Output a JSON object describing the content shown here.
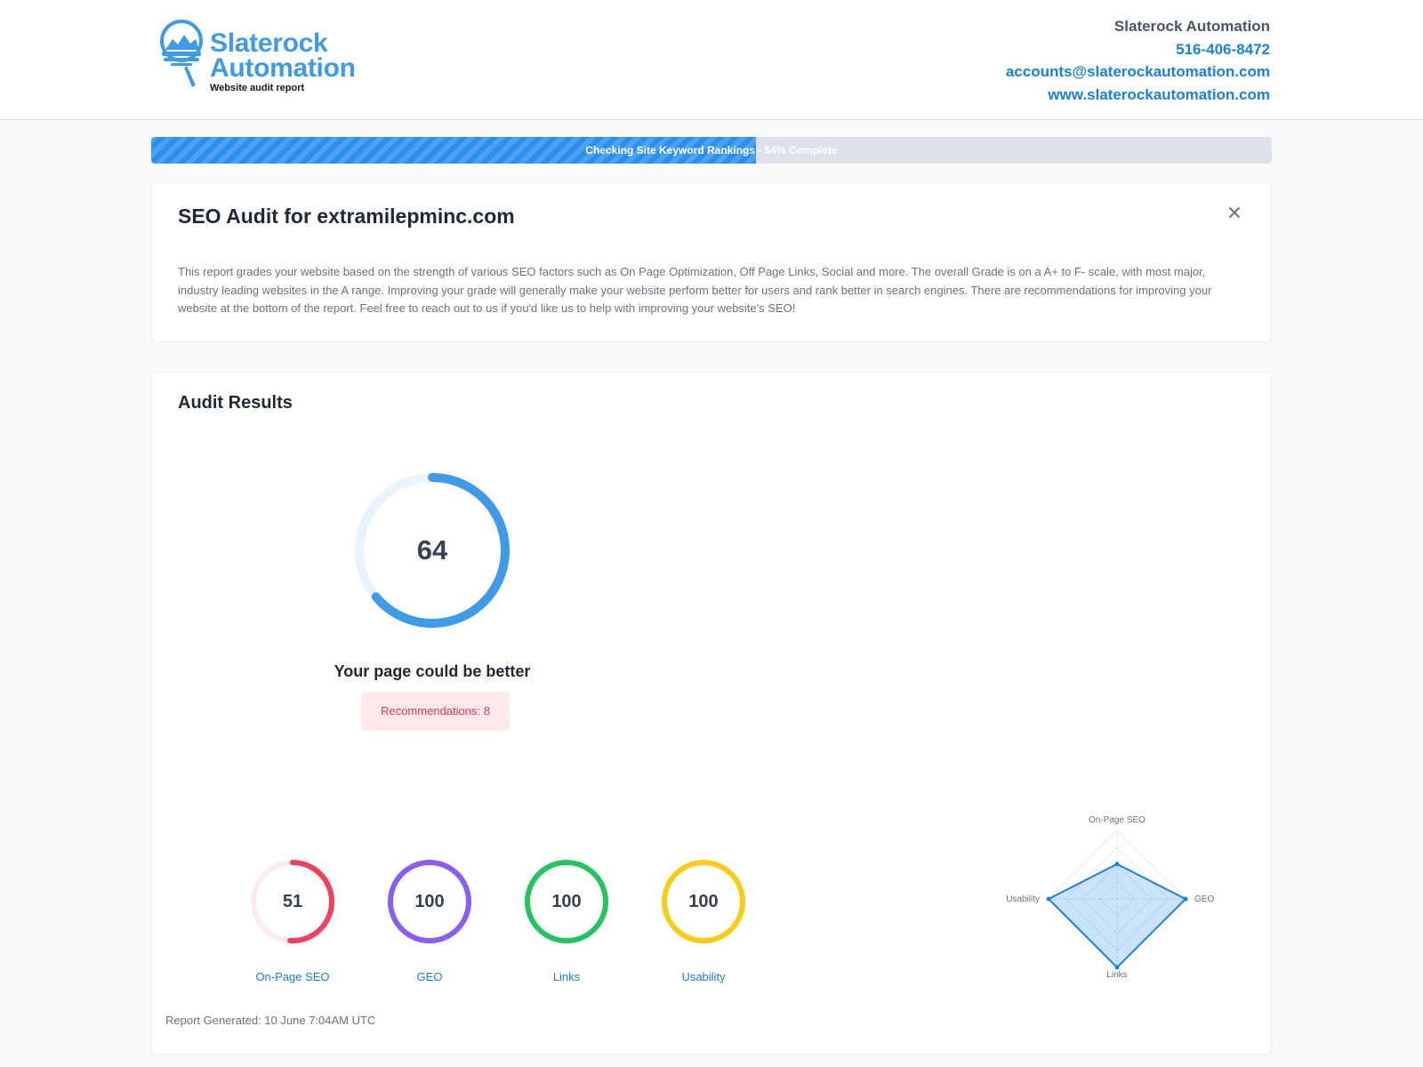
{
  "brand": {
    "line1": "Slaterock",
    "line2": "Automation",
    "tagline": "Website audit report",
    "accent": "#3d9be9"
  },
  "contact": {
    "company": "Slaterock Automation",
    "phone": "516-406-8472",
    "email": "accounts@slaterockautomation.com",
    "website": "www.slaterockautomation.com"
  },
  "progress": {
    "label": "Checking Site Keyword Rankings - 54% Complete",
    "fraction": 0.54
  },
  "intro": {
    "title": "SEO Audit for extramilepminc.com",
    "close_icon": "close-icon",
    "text": "This report grades your website based on the strength of various SEO factors such as On Page Optimization, Off Page Links, Social and more. The overall Grade is on a A+ to F- scale, with most major, industry leading websites in the A range. Improving your grade will generally make your website perform better for users and rank better in search engines. There are recommendations for improving your website at the bottom of the report. Feel free to reach out to us if you'd like us to help with improving your website's SEO!"
  },
  "results": {
    "title": "Audit Results",
    "overall_score": "64",
    "overall_fraction": 0.64,
    "overall_color": "#3d9be9",
    "verdict": "Your page could be better",
    "recommendations": "Recommendations: 8",
    "categories": [
      {
        "label": "On-Page SEO",
        "score": "51",
        "fraction": 0.51,
        "color": "#f43f5e"
      },
      {
        "label": "GEO",
        "score": "100",
        "fraction": 1,
        "color": "#8b5cf6"
      },
      {
        "label": "Links",
        "score": "100",
        "fraction": 1,
        "color": "#22c55e"
      },
      {
        "label": "Usability",
        "score": "100",
        "fraction": 1,
        "color": "#facc15"
      }
    ],
    "radar_labels": [
      "On-Page SEO",
      "GEO",
      "Links",
      "Usability"
    ],
    "report_generated": "Report Generated: 10 June 7:04AM UTC"
  }
}
